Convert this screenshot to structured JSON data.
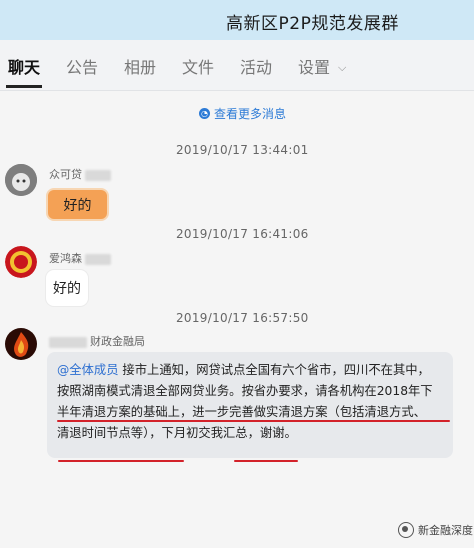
{
  "window": {
    "title": "高新区P2P规范发展群"
  },
  "tabs": [
    {
      "label": "聊天",
      "active": true
    },
    {
      "label": "公告"
    },
    {
      "label": "相册"
    },
    {
      "label": "文件"
    },
    {
      "label": "活动"
    },
    {
      "label": "设置"
    }
  ],
  "more_messages": {
    "label": "查看更多消息"
  },
  "messages": [
    {
      "time": "2019/10/17 13:44:01",
      "sender": "众可贷",
      "text": "好的"
    },
    {
      "time": "2019/10/17 16:41:06",
      "sender": "爱鸿森",
      "text": "好的"
    },
    {
      "time": "2019/10/17 16:57:50",
      "sender": "财政金融局",
      "mention": "@全体成员",
      "lines": [
        "接市上通知，网贷试点全国有六个省市，四川不在其中，",
        "按照湖南模式清退全部网贷业务。按省办要求，请各机构在2018年下",
        "半年清退方案的基础上，进一步完善做实清退方案（包括清退方式、",
        "清退时间节点等），下月初交我汇总，谢谢。"
      ]
    }
  ],
  "watermark": {
    "text": "新金融深度"
  },
  "colors": {
    "header_bg": "#cfe8f6",
    "link": "#2d7bd6",
    "annotation_red": "#d3222a",
    "orange_bubble": "#f4a155"
  }
}
